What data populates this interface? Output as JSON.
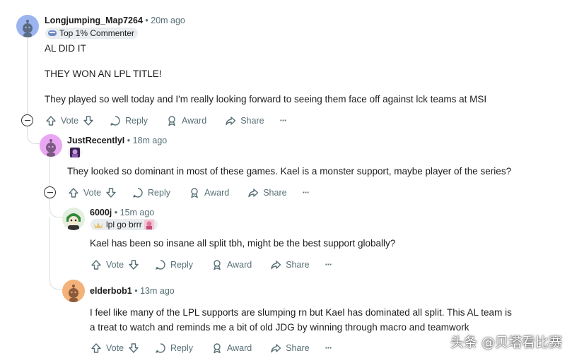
{
  "colors": {
    "meta": "#576f76",
    "thread_line": "#d7dcde",
    "flair_bg": "#eaedef"
  },
  "actions": {
    "vote": "Vote",
    "reply": "Reply",
    "award": "Award",
    "share": "Share",
    "more": "···"
  },
  "comments": [
    {
      "username": "Longjumping_Map7264",
      "time": "• 20m ago",
      "flair": "Top 1% Commenter",
      "body": [
        "AL DID IT",
        "THEY WON AN LPL TITLE!",
        "They played so well today and I'm really looking forward to seeing them face off against lck teams at MSI"
      ]
    },
    {
      "username": "JustRecentlyI",
      "time": "• 18m ago",
      "body": [
        "They looked so dominant in most of these games. Kael is a monster support, maybe player of the series?"
      ]
    },
    {
      "username": "6000j",
      "time": "• 15m ago",
      "flair": "lpl go brrr",
      "body": [
        "Kael has been so insane all split tbh, might be the best support globally?"
      ]
    },
    {
      "username": "elderbob1",
      "time": "• 13m ago",
      "body": [
        "I feel like many of the LPL supports are slumping rn but Kael has dominated all split. This AL team is",
        "a treat to watch and reminds me a bit of old JDG by winning through macro and teamwork"
      ]
    }
  ],
  "watermark": "头条 @贝塔看比赛"
}
